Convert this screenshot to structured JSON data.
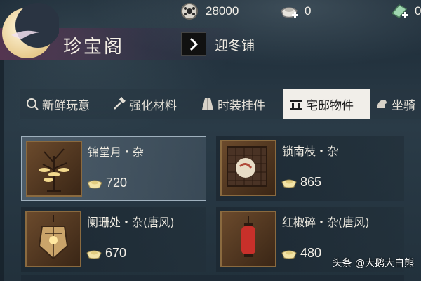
{
  "currencies": [
    {
      "icon": "coin-icon",
      "value": "28000"
    },
    {
      "icon": "ingot-plus-icon",
      "value": "0"
    },
    {
      "icon": "jade-plus-icon",
      "value": "0"
    }
  ],
  "header": {
    "title": "珍宝阁",
    "breadcrumb": "迎冬铺"
  },
  "tabs": [
    {
      "label": "新鲜玩意",
      "icon": "magnifier-icon",
      "active": false
    },
    {
      "label": "强化材料",
      "icon": "hammer-icon",
      "active": false
    },
    {
      "label": "时装挂件",
      "icon": "robe-icon",
      "active": false
    },
    {
      "label": "宅邸物件",
      "icon": "house-icon",
      "active": true
    },
    {
      "label": "坐骑",
      "icon": "mount-icon",
      "active": false
    }
  ],
  "items": [
    {
      "name": "锦堂月・杂",
      "price": "720",
      "selected": true
    },
    {
      "name": "锁南枝・杂",
      "price": "865",
      "selected": false
    },
    {
      "name": "阑珊处・杂(唐风)",
      "price": "670",
      "selected": false
    },
    {
      "name": "红椒碎・杂(唐风)",
      "price": "480",
      "selected": false
    }
  ],
  "watermark": {
    "text": "头条 @大鹅大白熊"
  },
  "colors": {
    "active_tab_bg": "#f1eee9",
    "title_band": "#78325a",
    "frame": "#8a6a3f"
  }
}
